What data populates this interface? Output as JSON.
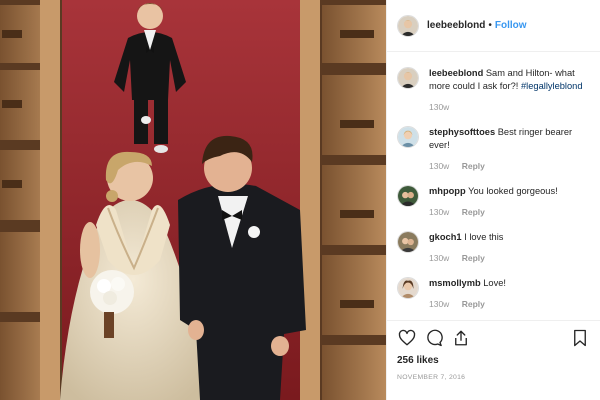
{
  "post": {
    "username": "leebeeblond",
    "follow_label": "Follow",
    "separator": "•"
  },
  "comments": [
    {
      "username": "leebeeblond",
      "text": "Sam and Hilton- what more could I ask for?!",
      "hashtag": "#legallyleblond",
      "time": "130w",
      "reply_label": ""
    },
    {
      "username": "stephysofttoes",
      "text": "Best ringer bearer ever!",
      "hashtag": "",
      "time": "130w",
      "reply_label": "Reply"
    },
    {
      "username": "mhpopp",
      "text": "You looked gorgeous!",
      "hashtag": "",
      "time": "130w",
      "reply_label": "Reply"
    },
    {
      "username": "gkoch1",
      "text": "I love this",
      "hashtag": "",
      "time": "130w",
      "reply_label": "Reply"
    },
    {
      "username": "msmollymb",
      "text": "Love!",
      "hashtag": "",
      "time": "130w",
      "reply_label": "Reply"
    }
  ],
  "footer": {
    "likes": "256 likes",
    "date": "NOVEMBER 7, 2016"
  },
  "icons": {
    "like": "heart-icon",
    "comment": "comment-icon",
    "share": "share-icon",
    "save": "bookmark-icon"
  },
  "colors": {
    "link": "#3897f0",
    "text": "#262626",
    "muted": "#999999",
    "carpet": "#8b2226"
  }
}
